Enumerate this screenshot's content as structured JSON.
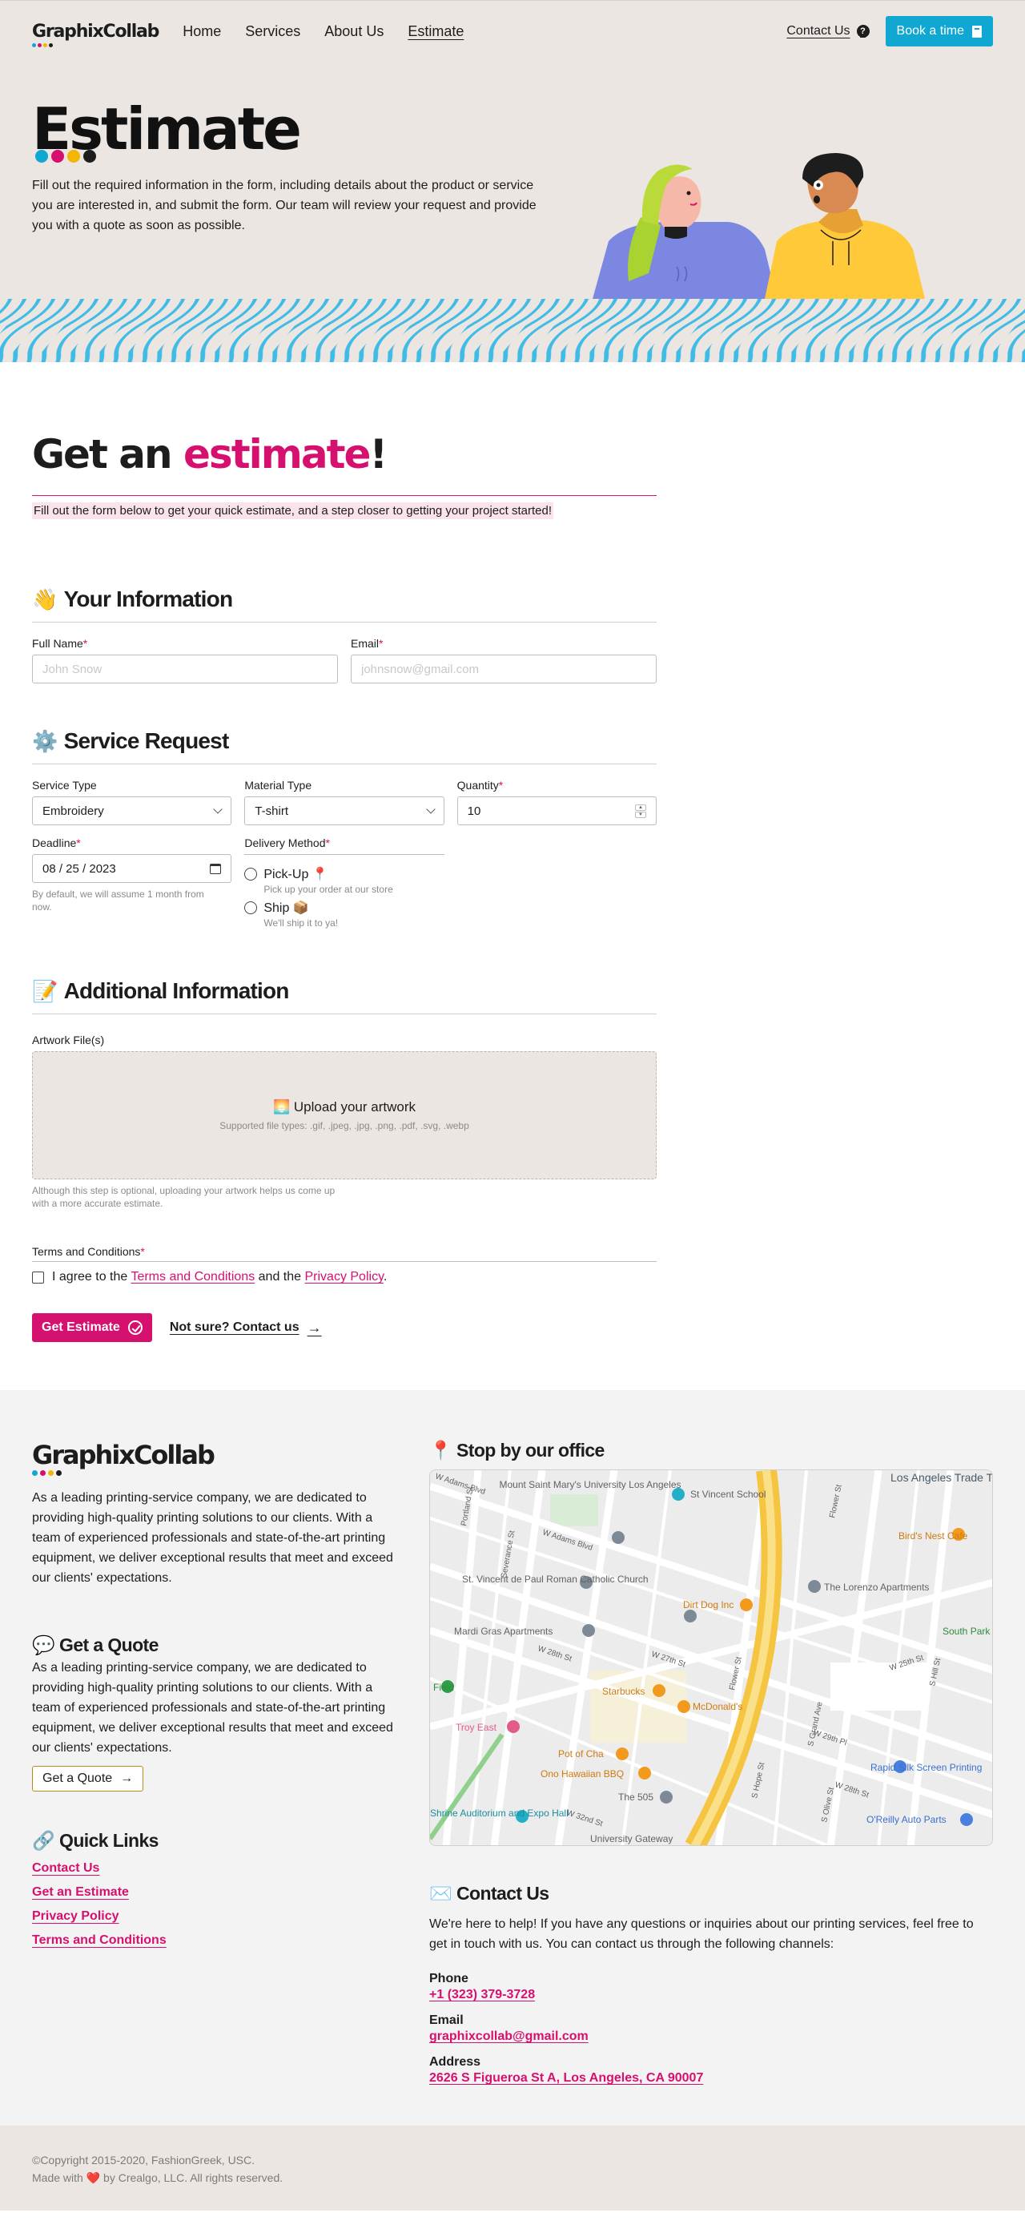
{
  "brand": {
    "name": "GraphixCollab",
    "dot_colors": [
      "#11a7d3",
      "#d6106e",
      "#f2b705",
      "#1d1d1d"
    ]
  },
  "nav": {
    "links": [
      {
        "label": "Home"
      },
      {
        "label": "Services"
      },
      {
        "label": "About Us"
      },
      {
        "label": "Estimate"
      }
    ],
    "contact_label": "Contact Us",
    "book_label": "Book a time"
  },
  "hero": {
    "title": "Estimate",
    "description": "Fill out the required information in the form, including details about the product or service you are interested in, and submit the form. Our team will review your request and provide you with a quote as soon as possible."
  },
  "form": {
    "title_prefix": "Get an ",
    "title_accent": "estimate",
    "title_suffix": "!",
    "lead": "Fill out the form below to get your quick estimate, and a step closer to getting your project started!",
    "your_info": {
      "emoji": "👋",
      "title": "Your Information",
      "full_name_label": "Full Name",
      "full_name_placeholder": "John Snow",
      "email_label": "Email",
      "email_placeholder": "johnsnow@gmail.com"
    },
    "service": {
      "emoji": "⚙️",
      "title": "Service Request",
      "service_type_label": "Service Type",
      "service_type_value": "Embroidery",
      "material_type_label": "Material Type",
      "material_type_value": "T-shirt",
      "quantity_label": "Quantity",
      "quantity_value": "10",
      "deadline_label": "Deadline",
      "deadline_value": "08 / 25 / 2023",
      "deadline_hint": "By default, we will assume 1 month from now.",
      "delivery_label": "Delivery Method",
      "pickup_label": "Pick-Up 📍",
      "pickup_hint": "Pick up your order at our store",
      "ship_label": "Ship 📦",
      "ship_hint": "We'll ship it to ya!"
    },
    "additional": {
      "emoji": "📝",
      "title": "Additional Information",
      "artwork_label": "Artwork File(s)",
      "upload_title": "🌅 Upload your artwork",
      "upload_types": "Supported file types: .gif, .jpeg, .jpg, .png, .pdf, .svg, .webp",
      "upload_hint": "Although this step is optional, uploading your artwork helps us come up with a more accurate estimate."
    },
    "terms": {
      "label": "Terms and Conditions",
      "agree_prefix": "I agree to the ",
      "terms_link": "Terms and Conditions",
      "and": " and the ",
      "privacy_link": "Privacy Policy",
      "period": "."
    },
    "submit_label": "Get Estimate",
    "not_sure_label": "Not sure? Contact us"
  },
  "footer": {
    "about": "As a leading printing-service company, we are dedicated to providing high-quality printing solutions to our clients. With a team of experienced professionals and state-of-the-art printing equipment, we deliver exceptional results that meet and exceed our clients' expectations.",
    "quote": {
      "emoji": "💬",
      "title": "Get a Quote",
      "text": "As a leading printing-service company, we are dedicated to providing high-quality printing solutions to our clients. With a team of experienced professionals and state-of-the-art printing equipment, we deliver exceptional results that meet and exceed our clients' expectations.",
      "button": "Get a Quote"
    },
    "quick_links": {
      "emoji": "🔗",
      "title": "Quick Links",
      "items": [
        {
          "label": "Contact Us"
        },
        {
          "label": "Get an Estimate"
        },
        {
          "label": "Privacy Policy"
        },
        {
          "label": "Terms and Conditions"
        }
      ]
    },
    "office": {
      "emoji": "📍",
      "title": "Stop by our office",
      "map_labels": {
        "mount_saint_marys": "Mount Saint Mary's University Los Angeles",
        "st_vincent_school": "St Vincent School",
        "la_trade_tech": "Los Angeles Trade Technical College",
        "birds_nest": "Bird's Nest Cafe",
        "st_vincent_church": "St. Vincent de Paul Roman Catholic Church",
        "lorenzo": "The Lorenzo Apartments",
        "mardi_gras": "Mardi Gras Apartments",
        "dirt_dog": "Dirt Dog Inc",
        "south_park": "South Park - Doggiela",
        "starbucks": "Starbucks",
        "mcdonalds": "McDonald's",
        "field": "Field",
        "troy_east": "Troy East",
        "pot_of_cha": "Pot of Cha",
        "ono_bbq": "Ono Hawaiian BBQ",
        "rapid_silk": "Rapid Silk Screen Printing",
        "the_505": "The 505",
        "shrine": "Shrine Auditorium and Expo Hall",
        "oreilly": "O'Reilly Auto Parts",
        "univ_gateway": "University Gateway",
        "streets": [
          "W Adams Blvd",
          "W Adams Blvd",
          "W 28th St",
          "W 27th St",
          "W 29th Pl",
          "W 25th St",
          "Flower St",
          "Severance St",
          "Portland St",
          "S Grand Ave",
          "S Hope St",
          "S Olive St",
          "W 32nd St",
          "W 28th St",
          "S Hill St",
          "Flower St"
        ]
      }
    },
    "contact": {
      "emoji": "✉️",
      "title": "Contact Us",
      "intro": "We're here to help! If you have any questions or inquiries about our printing services, feel free to get in touch with us. You can contact us through the following channels:",
      "phone_label": "Phone",
      "phone": "+1 (323) 379-3728",
      "email_label": "Email",
      "email": "graphixcollab@gmail.com",
      "address_label": "Address",
      "address": "2626 S Figueroa St A, Los Angeles, CA 90007"
    }
  },
  "copyright": {
    "line1": "©Copyright 2015-2020, FashionGreek, USC.",
    "line2_prefix": "Made with ",
    "heart": "❤️",
    "line2_suffix": " by Crealgo, LLC. All rights reserved."
  },
  "colors": {
    "accent": "#d6106e",
    "blue": "#11a7d3",
    "hero_bg": "#ece6e3",
    "footer_bg": "#f4f3f3"
  }
}
